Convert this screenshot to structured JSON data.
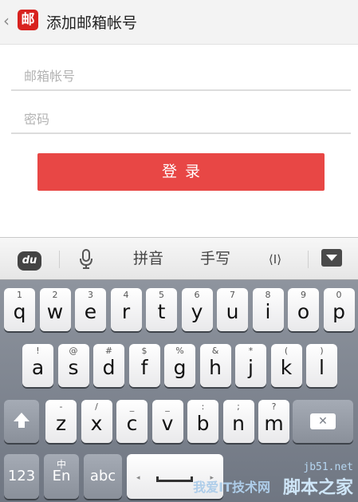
{
  "header": {
    "back_glyph": "‹",
    "app_icon_text": "邮",
    "title": "添加邮箱帐号"
  },
  "form": {
    "email_placeholder": "邮箱帐号",
    "password_placeholder": "密码",
    "login_label": "登录"
  },
  "keyboard_toolbar": {
    "bear_text": "du",
    "mic_icon": "microphone-icon",
    "pinyin_label": "拼音",
    "handwrite_label": "手写",
    "cursor_glyph": "⟨I⟩",
    "hide_icon": "hide-keyboard-icon"
  },
  "keyboard": {
    "row1": [
      {
        "alt": "1",
        "main": "q"
      },
      {
        "alt": "2",
        "main": "w"
      },
      {
        "alt": "3",
        "main": "e"
      },
      {
        "alt": "4",
        "main": "r"
      },
      {
        "alt": "5",
        "main": "t"
      },
      {
        "alt": "6",
        "main": "y"
      },
      {
        "alt": "7",
        "main": "u"
      },
      {
        "alt": "8",
        "main": "i"
      },
      {
        "alt": "9",
        "main": "o"
      },
      {
        "alt": "0",
        "main": "p"
      }
    ],
    "row2": [
      {
        "alt": "!",
        "main": "a"
      },
      {
        "alt": "@",
        "main": "s"
      },
      {
        "alt": "#",
        "main": "d"
      },
      {
        "alt": "$",
        "main": "f"
      },
      {
        "alt": "%",
        "main": "g"
      },
      {
        "alt": "&",
        "main": "h"
      },
      {
        "alt": "*",
        "main": "j"
      },
      {
        "alt": "(",
        "main": "k"
      },
      {
        "alt": ")",
        "main": "l"
      }
    ],
    "row3": [
      {
        "alt": "-",
        "main": "z"
      },
      {
        "alt": "/",
        "main": "x"
      },
      {
        "alt": "_",
        "main": "c"
      },
      {
        "alt": "_",
        "main": "v"
      },
      {
        "alt": ":",
        "main": "b"
      },
      {
        "alt": ";",
        "main": "n"
      },
      {
        "alt": "?",
        "main": "m"
      }
    ],
    "backspace_glyph": "✕",
    "k123": "123",
    "en_alt": "中",
    "en_main": "En",
    "abc": "abc",
    "space_left_dot": "◂",
    "space_right_dot": "▸"
  },
  "watermark": {
    "site": "jb51.net",
    "brand": "脚本之家",
    "brand2": "我爱IT技术网"
  }
}
